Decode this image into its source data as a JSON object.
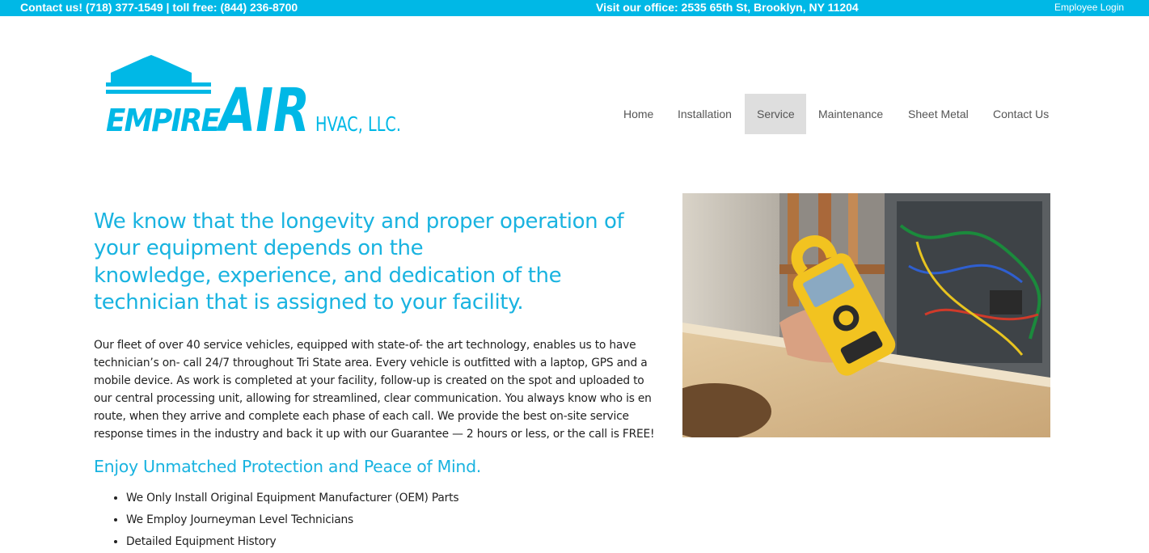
{
  "topbar": {
    "contact": "Contact us! (718) 377-1549 | toll free: (844) 236-8700",
    "office": "Visit our office: 2535 65th St, Brooklyn, NY 11204",
    "employee_login": "Employee Login"
  },
  "logo": {
    "word1": "EMPIRE",
    "word2": "AIR",
    "suffix": "HVAC, LLC."
  },
  "nav": {
    "items": [
      {
        "label": "Home"
      },
      {
        "label": "Installation"
      },
      {
        "label": "Service",
        "active": true
      },
      {
        "label": "Maintenance"
      },
      {
        "label": "Sheet Metal"
      },
      {
        "label": "Contact Us"
      }
    ]
  },
  "main": {
    "headline_lines": [
      "We know that the longevity and proper operation of",
      "your equipment depends on the",
      "knowledge, experience, and dedication of the",
      "technician that is assigned to your facility."
    ],
    "body": "Our fleet of over 40 service vehicles, equipped with state-of- the art technology, enables us to have technician’s on- call 24/7 throughout Tri State area. Every vehicle is outfitted with a laptop, GPS and a mobile device. As work is completed at your facility, follow-up is created on the spot and uploaded to our central processing unit, allowing for streamlined, clear communication. You always know who is en route, when they arrive and complete each phase of each call. We provide the best on-site service response times in the industry and back it up with our Guarantee — 2 hours or less, or the call is FREE!",
    "subheading": "Enjoy Unmatched Protection and Peace of Mind.",
    "bullets": [
      "We Only Install Original Equipment Manufacturer (OEM) Parts",
      "We Employ Journeyman Level Technicians",
      "Detailed Equipment History"
    ]
  },
  "colors": {
    "accent": "#00b8e6",
    "heading": "#19b3e0",
    "nav_active_bg": "#dedede"
  }
}
